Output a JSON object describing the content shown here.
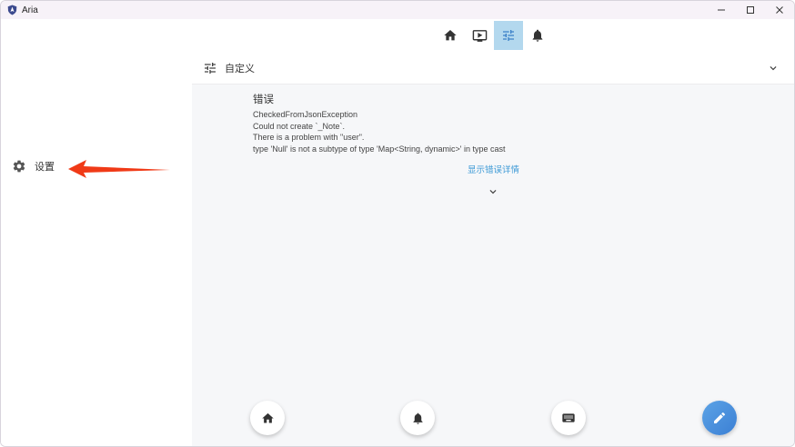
{
  "window": {
    "title": "Aria",
    "controls": [
      "minimize",
      "maximize",
      "close"
    ]
  },
  "sidebar": {
    "settings_label": "设置",
    "settings_icon": "gear-icon"
  },
  "top_nav": {
    "tabs": [
      {
        "icon": "home-icon",
        "active": false
      },
      {
        "icon": "tv-icon",
        "active": true
      },
      {
        "icon": "sliders-icon",
        "active": true
      },
      {
        "icon": "bell-icon",
        "active": false
      }
    ]
  },
  "section": {
    "title": "自定义",
    "icon": "sliders-icon"
  },
  "error": {
    "title": "错误",
    "lines": [
      "CheckedFromJsonException",
      "Could not create `_Note`.",
      "There is a problem with \"user\".",
      "type 'Null' is not a subtype of type 'Map<String, dynamic>' in type cast"
    ],
    "details_link": "显示错误详情"
  },
  "fabs": [
    {
      "icon": "home-icon"
    },
    {
      "icon": "bell-icon"
    },
    {
      "icon": "keyboard-icon"
    },
    {
      "icon": "pencil-icon"
    }
  ],
  "colors": {
    "accent": "#3d9ad6",
    "active_tab_bg": "#b3d8ee",
    "annotation_arrow": "#f03a17",
    "fab_primary": "#4a90dc"
  }
}
